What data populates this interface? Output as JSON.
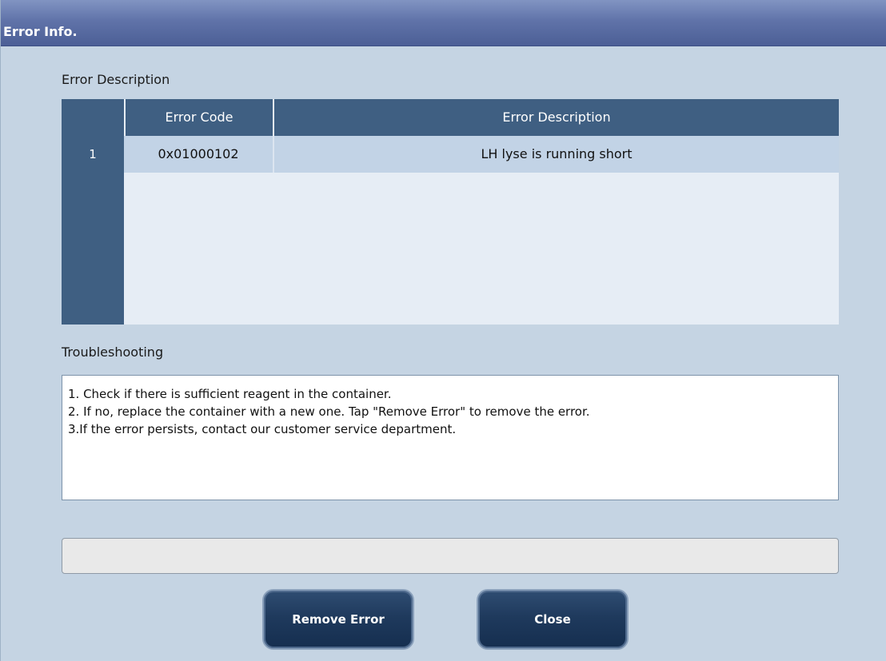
{
  "window": {
    "title": "Error Info."
  },
  "error_section": {
    "label": "Error Description",
    "columns": [
      "",
      "Error Code",
      "Error Description"
    ],
    "rows": [
      {
        "index": "1",
        "code": "0x01000102",
        "description": "LH lyse is running short"
      }
    ]
  },
  "troubleshooting": {
    "label": "Troubleshooting",
    "lines": [
      "1. Check if there is sufficient reagent in the container.",
      "2. If no, replace the container with a new one. Tap \"Remove Error\" to remove the error.",
      "3.If the error persists, contact our customer service department."
    ]
  },
  "status_bar": {
    "text": ""
  },
  "buttons": {
    "remove_error": "Remove Error",
    "close": "Close"
  },
  "colors": {
    "title_bar": "#5f72a8",
    "background": "#c5d4e3",
    "table_header": "#3f5f82",
    "selected_row": "#c2d3e6",
    "button": "#1f3a5d"
  }
}
